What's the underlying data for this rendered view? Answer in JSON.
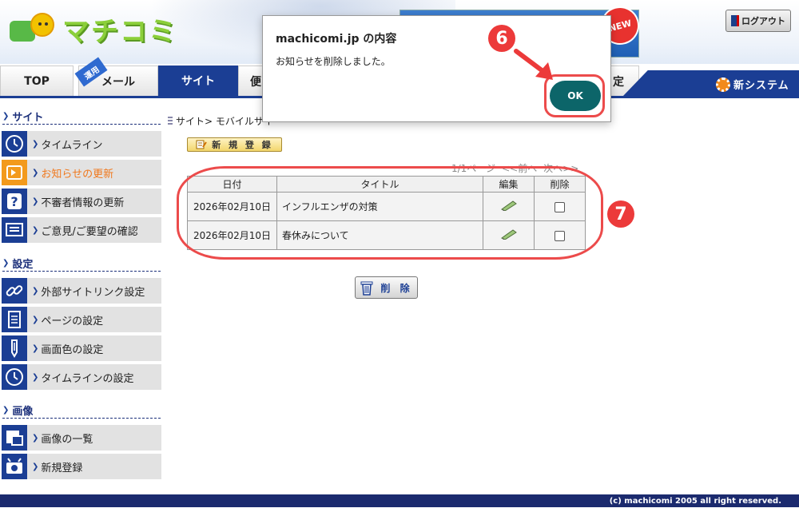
{
  "header": {
    "logo_text": "マチコミ",
    "banner_new": "NEW",
    "logout_label": "ログアウト"
  },
  "tabs": [
    {
      "label": "TOP",
      "active": false
    },
    {
      "label": "メール",
      "active": false,
      "ribbon": "運用"
    },
    {
      "label": "サイト",
      "active": true
    },
    {
      "label": "便",
      "active": false
    },
    {
      "label": "定",
      "active": false
    }
  ],
  "navbar_right_label": "新システム",
  "sidebar": {
    "sections": [
      {
        "title": "サイト",
        "items": [
          {
            "label": "タイムライン",
            "icon": "clock-icon",
            "active": false
          },
          {
            "label": "お知らせの更新",
            "icon": "notice-icon",
            "active": true
          },
          {
            "label": "不審者情報の更新",
            "icon": "question-icon",
            "active": false
          },
          {
            "label": "ご意見/ご要望の確認",
            "icon": "comment-icon",
            "active": false
          }
        ]
      },
      {
        "title": "設定",
        "items": [
          {
            "label": "外部サイトリンク設定",
            "icon": "link-icon",
            "active": false
          },
          {
            "label": "ページの設定",
            "icon": "page-icon",
            "active": false
          },
          {
            "label": "画面色の設定",
            "icon": "pencil-icon",
            "active": false
          },
          {
            "label": "タイムラインの設定",
            "icon": "clock-icon",
            "active": false
          }
        ]
      },
      {
        "title": "画像",
        "items": [
          {
            "label": "画像の一覧",
            "icon": "image-list-icon",
            "active": false
          },
          {
            "label": "新規登録",
            "icon": "camera-icon",
            "active": false
          }
        ]
      }
    ]
  },
  "main": {
    "breadcrumb": "サイト> モバイルサイ",
    "new_register_label": "新 規 登 録",
    "pager": [
      "1/1ページ",
      "<<前へ",
      "次へ>>"
    ],
    "table": {
      "headers": [
        "日付",
        "タイトル",
        "編集",
        "削除"
      ],
      "rows": [
        {
          "date": "2026年02月10日",
          "title": "インフルエンザの対策"
        },
        {
          "date": "2026年02月10日",
          "title": "春休みについて"
        }
      ]
    },
    "delete_label": "削 除"
  },
  "footer_text": "(c) machicomi 2005 all right reserved.",
  "dialog": {
    "title": "machicomi.jp の内容",
    "message": "お知らせを削除しました。",
    "ok_label": "OK"
  },
  "annotations": {
    "step6": "6",
    "step7": "7",
    "color": "#ec4b4b"
  },
  "colors": {
    "nav_blue": "#1b3e94",
    "ok_teal": "#0c6569",
    "active_orange": "#f39a1c"
  }
}
